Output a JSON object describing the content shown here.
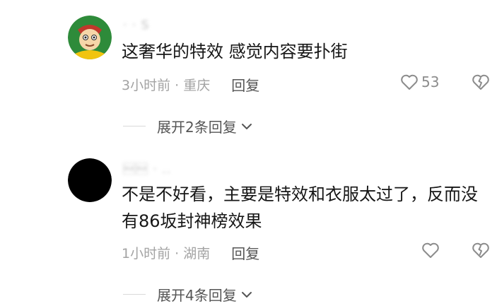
{
  "comments": [
    {
      "username": "·  ·  S",
      "text": "这奢华的特效 感觉内容要扑街",
      "time_location": "3小时前 · 重庆",
      "reply_label": "回复",
      "likes": "53",
      "expand_label": "展开2条回复"
    },
    {
      "username": "\u0010\u0010 ·  ..",
      "text": "不是不好看，主要是特效和衣服太过了，反而没有86坂封神榜效果",
      "time_location": "1小时前 · 湖南",
      "reply_label": "回复",
      "likes": "",
      "expand_label": "展开4条回复"
    }
  ],
  "icons": {
    "like": "heart-outline-icon",
    "dislike": "broken-heart-icon",
    "expand": "chevron-down-icon"
  },
  "colors": {
    "text": "#161616",
    "meta": "#a3a3a3",
    "reply": "#555555",
    "avatar_green": "#2e8b3a"
  }
}
